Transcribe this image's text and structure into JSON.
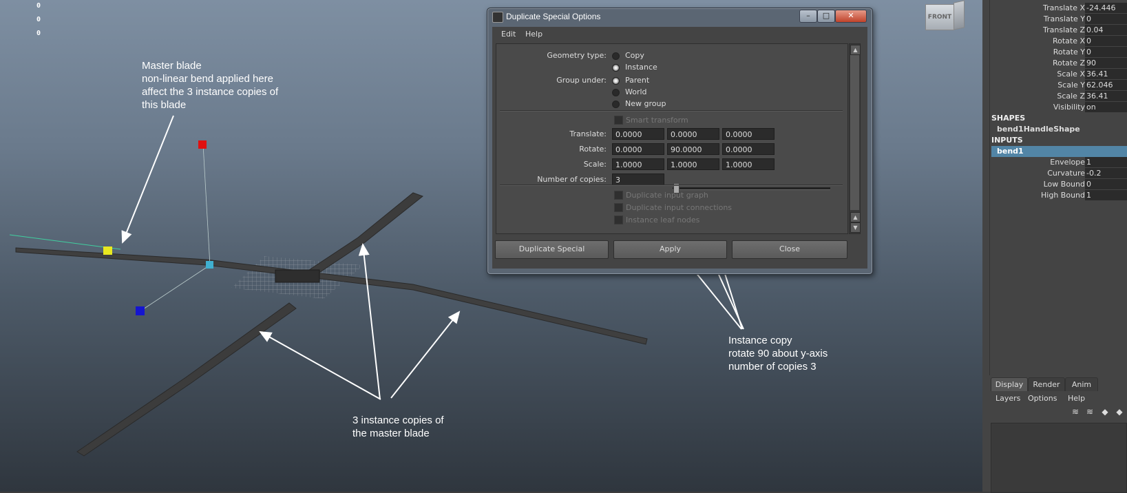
{
  "viewport": {
    "hud_values": [
      "0",
      "0",
      "0"
    ],
    "viewcube_label": "FRONT",
    "annotations": {
      "master_blade": [
        "Master blade",
        "non-linear bend applied here",
        "affect the 3 instance copies of",
        "this blade"
      ],
      "instance_copies": [
        "3 instance copies of",
        "the master blade"
      ],
      "instance_copy_settings": [
        "Instance copy",
        "rotate 90 about y-axis",
        "number of copies 3"
      ]
    },
    "colors": {
      "handle_red": "#e01010",
      "handle_blue": "#1010d0",
      "handle_yellow": "#e8e820",
      "handle_cyan": "#40b0d0",
      "blade": "#3e3e3e"
    }
  },
  "dialog": {
    "title": "Duplicate Special Options",
    "window_buttons": [
      "–",
      "□",
      "✕"
    ],
    "menu": [
      "Edit",
      "Help"
    ],
    "geometry_type": {
      "label": "Geometry type:",
      "options": [
        {
          "label": "Copy",
          "selected": false
        },
        {
          "label": "Instance",
          "selected": true
        }
      ]
    },
    "group_under": {
      "label": "Group under:",
      "options": [
        {
          "label": "Parent",
          "selected": true
        },
        {
          "label": "World",
          "selected": false
        },
        {
          "label": "New group",
          "selected": false
        }
      ]
    },
    "smart_transform": "Smart transform",
    "translate": {
      "label": "Translate:",
      "values": [
        "0.0000",
        "0.0000",
        "0.0000"
      ]
    },
    "rotate": {
      "label": "Rotate:",
      "values": [
        "0.0000",
        "90.0000",
        "0.0000"
      ]
    },
    "scale": {
      "label": "Scale:",
      "values": [
        "1.0000",
        "1.0000",
        "1.0000"
      ]
    },
    "copies": {
      "label": "Number of copies:",
      "value": "3"
    },
    "checkboxes": [
      "Duplicate input graph",
      "Duplicate input connections",
      "Instance leaf nodes"
    ],
    "buttons": [
      "Duplicate Special",
      "Apply",
      "Close"
    ]
  },
  "channel_box": {
    "transform_attrs": [
      {
        "name": "Translate X",
        "value": "-24.446"
      },
      {
        "name": "Translate Y",
        "value": "0"
      },
      {
        "name": "Translate Z",
        "value": "0.04"
      },
      {
        "name": "Rotate X",
        "value": "0"
      },
      {
        "name": "Rotate Y",
        "value": "0"
      },
      {
        "name": "Rotate Z",
        "value": "90"
      },
      {
        "name": "Scale X",
        "value": "36.41"
      },
      {
        "name": "Scale Y",
        "value": "62.046"
      },
      {
        "name": "Scale Z",
        "value": "36.41"
      },
      {
        "name": "Visibility",
        "value": "on"
      }
    ],
    "shapes_header": "SHAPES",
    "shape_name": "bend1HandleShape",
    "inputs_header": "INPUTS",
    "input_name": "bend1",
    "input_attrs": [
      {
        "name": "Envelope",
        "value": "1"
      },
      {
        "name": "Curvature",
        "value": "-0.2"
      },
      {
        "name": "Low Bound",
        "value": "0"
      },
      {
        "name": "High Bound",
        "value": "1"
      }
    ]
  },
  "layer_editor": {
    "tabs": [
      "Display",
      "Render",
      "Anim"
    ],
    "menu": [
      "Layers",
      "Options",
      "Help"
    ]
  }
}
